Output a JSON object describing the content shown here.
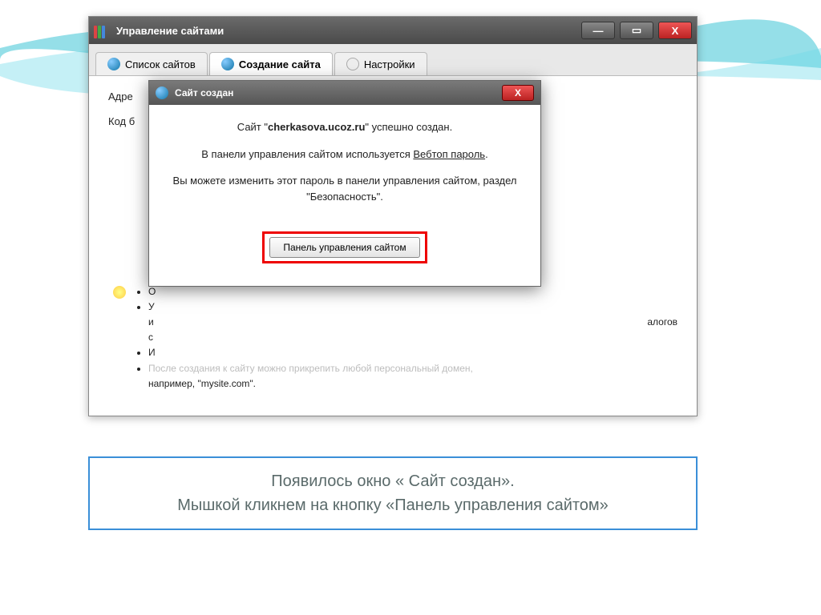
{
  "main_window": {
    "title": "Управление сайтами",
    "tabs": [
      {
        "label": "Список сайтов"
      },
      {
        "label": "Создание сайта"
      },
      {
        "label": "Настройки"
      }
    ],
    "fields": {
      "address_label": "Адре",
      "code_label": "Код б"
    },
    "tips": {
      "line1": "О",
      "line2": "У",
      "line3": "и",
      "line3_suffix": "алогов",
      "line4": "с",
      "line5": "И",
      "line6_prefix": "После создания к сайту можно прикрепить любой персональный домен,",
      "line6": "например, \"mysite.com\"."
    }
  },
  "dialog": {
    "title": "Сайт создан",
    "line1_pre": "Сайт \"",
    "line1_bold": "cherkasova.ucoz.ru",
    "line1_post": "\" успешно создан.",
    "line2_pre": "В панели управления сайтом используется ",
    "line2_link": "Вебтоп пароль",
    "line2_post": ".",
    "line3": "Вы можете изменить этот пароль в панели управления сайтом, раздел \"Безопасность\".",
    "button": "Панель управления сайтом"
  },
  "caption": {
    "line1": "Появилось окно « Сайт создан».",
    "line2": "Мышкой кликнем на кнопку «Панель управления сайтом»"
  }
}
